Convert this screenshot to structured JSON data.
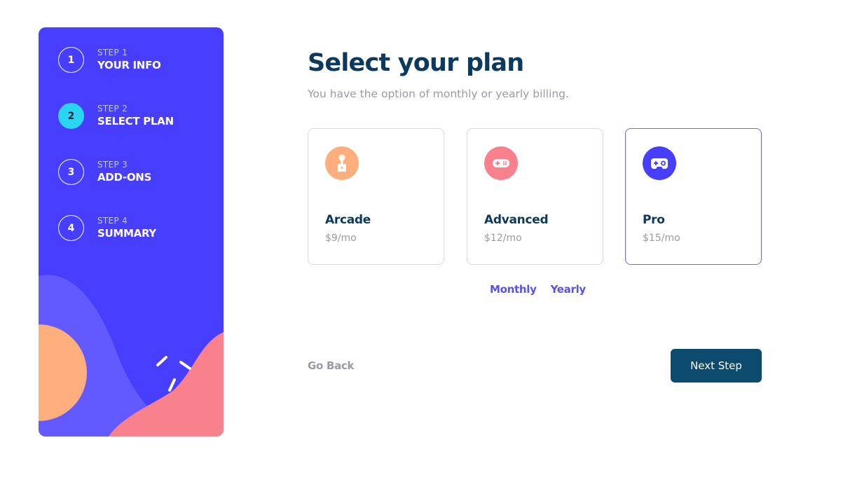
{
  "sidebar": {
    "steps": [
      {
        "number": "1",
        "label": "STEP 1",
        "title": "YOUR INFO",
        "active": false
      },
      {
        "number": "2",
        "label": "STEP 2",
        "title": "SELECT PLAN",
        "active": true
      },
      {
        "number": "3",
        "label": "STEP 3",
        "title": "ADD-ONS",
        "active": false
      },
      {
        "number": "4",
        "label": "STEP 4",
        "title": "SUMMARY",
        "active": false
      }
    ]
  },
  "main": {
    "title": "Select your plan",
    "subtitle": "You have the option of monthly or yearly billing.",
    "plans": [
      {
        "name": "Arcade",
        "price": "$9/mo",
        "icon": "arcade-icon",
        "color": "#ffaf7e",
        "selected": false
      },
      {
        "name": "Advanced",
        "price": "$12/mo",
        "icon": "gamepad-icon",
        "color": "#f9818e",
        "selected": false
      },
      {
        "name": "Pro",
        "price": "$15/mo",
        "icon": "controller-icon",
        "color": "#483eff",
        "selected": true
      }
    ],
    "billing": {
      "monthly": "Monthly",
      "yearly": "Yearly"
    },
    "go_back": "Go Back",
    "next_step": "Next Step"
  },
  "colors": {
    "sidebar_bg": "#483eff",
    "active_step": "#2ad6ef",
    "title": "#0c3a5e",
    "accent": "#5753e6",
    "button_bg": "#0c4a6e"
  }
}
